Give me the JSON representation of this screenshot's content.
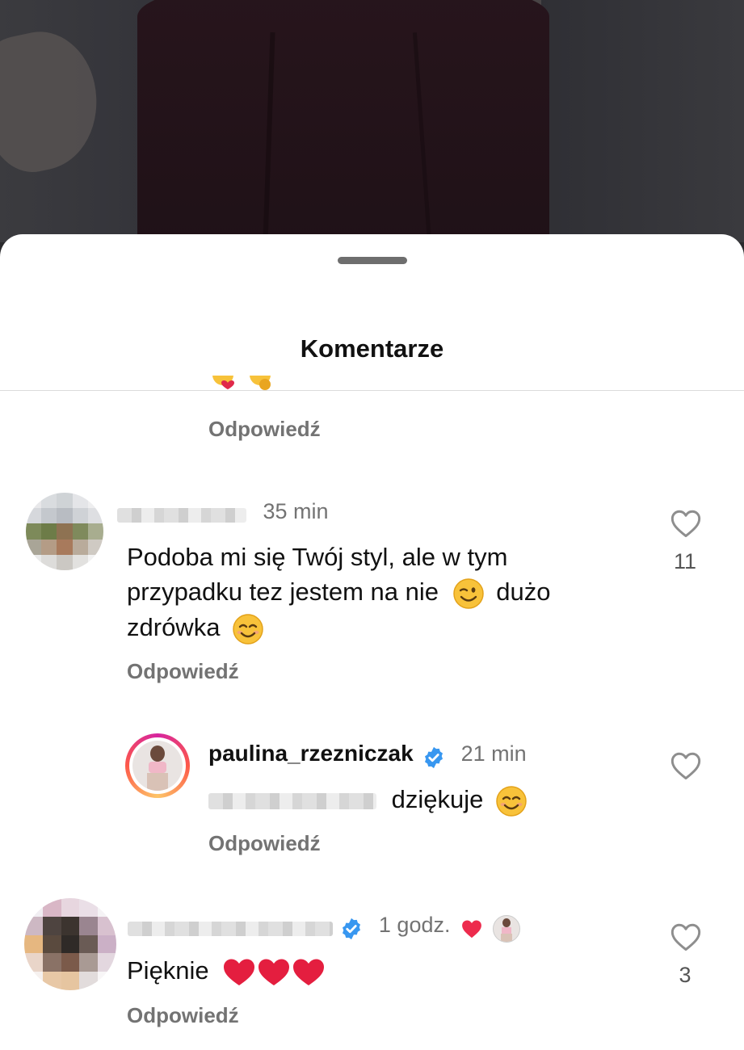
{
  "sheet": {
    "title": "Komentarze"
  },
  "comments": [
    {
      "reply_label": "Odpowiedź"
    },
    {
      "time": "35 min",
      "text_line1": "Podoba mi się Twój styl, ale w tym",
      "text_line2_a": "przypadku tez jestem na nie",
      "text_line2_b": "dużo",
      "text_line3": "zdrówka",
      "likes": "11",
      "reply_label": "Odpowiedź"
    },
    {
      "username": "paulina_rzezniczak",
      "time": "21 min",
      "text": "dziękuje",
      "reply_label": "Odpowiedź"
    },
    {
      "time": "1 godz.",
      "text": "Pięknie",
      "likes": "3",
      "reply_label": "Odpowiedź"
    }
  ],
  "colors": {
    "verified": "#3897f0",
    "heart": "#ed2b4d",
    "muted": "#737373"
  },
  "icons": [
    "heart-outline-icon",
    "verified-badge-icon",
    "red-heart-icon",
    "wink-emoji-icon",
    "smile-emoji-icon"
  ]
}
